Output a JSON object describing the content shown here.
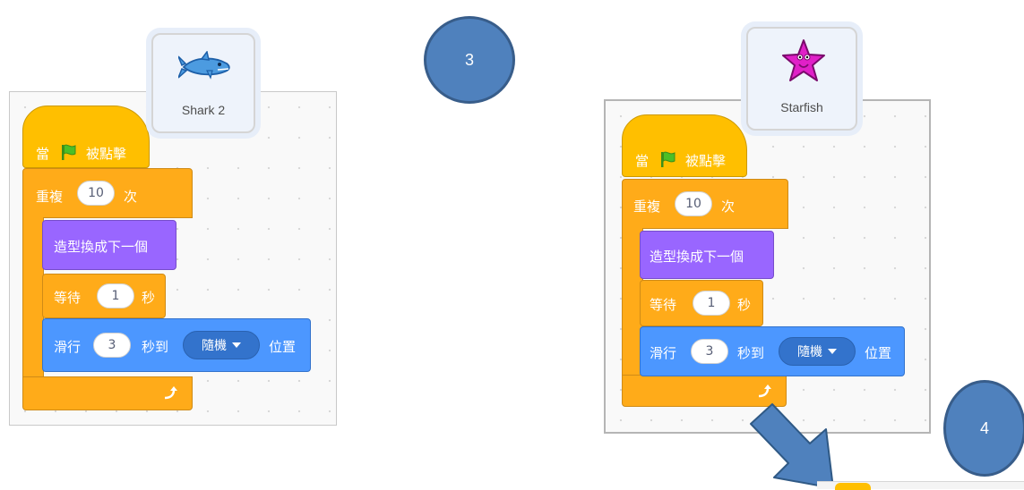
{
  "left_sprite": {
    "name": "Shark 2",
    "icon": "shark-icon",
    "color": "#4c9be0"
  },
  "right_sprite": {
    "name": "Starfish",
    "icon": "starfish-icon",
    "color": "#e020c8"
  },
  "step_badges": [
    "3",
    "4"
  ],
  "script": {
    "when_flag": {
      "prefix": "當",
      "suffix": "被點擊"
    },
    "repeat": {
      "label": "重複",
      "times": "10",
      "unit": "次"
    },
    "next_costume": "造型換成下一個",
    "wait": {
      "label": "等待",
      "secs": "1",
      "unit": "秒"
    },
    "glide": {
      "label": "滑行",
      "secs": "3",
      "unit": "秒到",
      "target": "隨機",
      "suffix": "位置"
    }
  },
  "colors": {
    "event": "#ffbf00",
    "control": "#ffab19",
    "looks": "#9966ff",
    "motion": "#4c97ff",
    "badge": "#4f81bd",
    "arrow": "#4f81bd"
  }
}
